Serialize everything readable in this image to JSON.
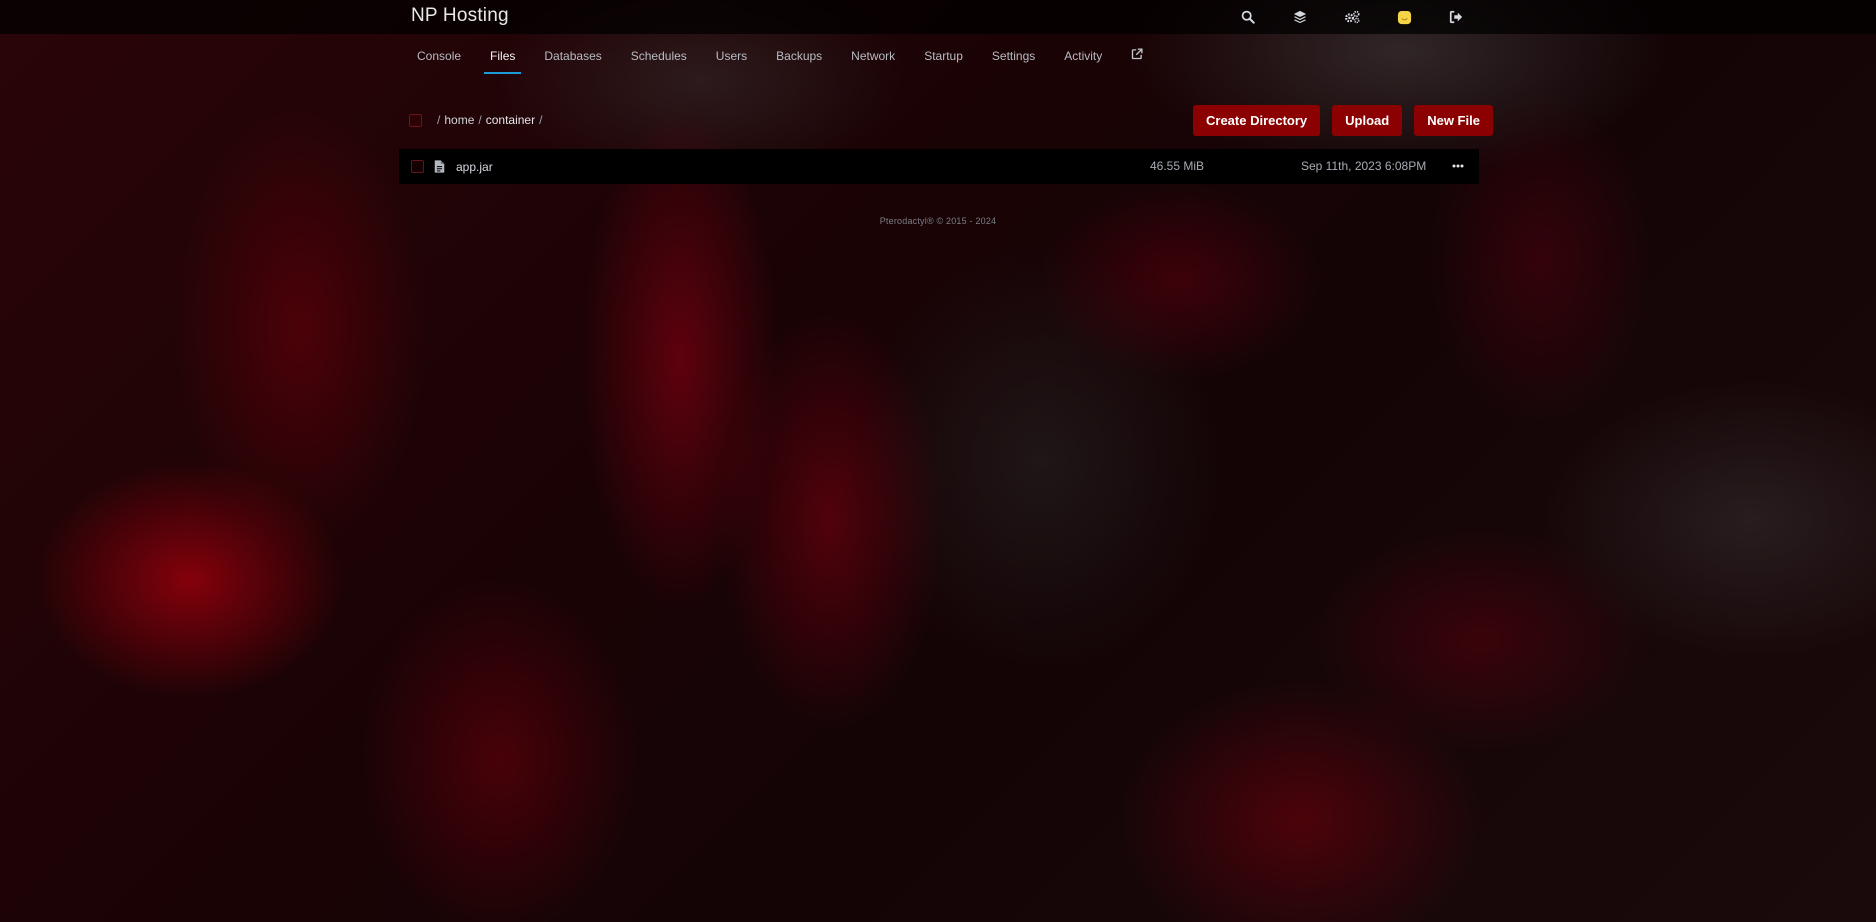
{
  "header": {
    "brand": "NP Hosting",
    "icons": [
      "search-icon",
      "layers-icon",
      "cogs-icon",
      "user-avatar-icon",
      "logout-icon"
    ]
  },
  "tabs": [
    {
      "label": "Console",
      "active": false
    },
    {
      "label": "Files",
      "active": true
    },
    {
      "label": "Databases",
      "active": false
    },
    {
      "label": "Schedules",
      "active": false
    },
    {
      "label": "Users",
      "active": false
    },
    {
      "label": "Backups",
      "active": false
    },
    {
      "label": "Network",
      "active": false
    },
    {
      "label": "Startup",
      "active": false
    },
    {
      "label": "Settings",
      "active": false
    },
    {
      "label": "Activity",
      "active": false
    }
  ],
  "breadcrumb": {
    "home": "home",
    "current": "container"
  },
  "actions": {
    "create_directory": "Create Directory",
    "upload": "Upload",
    "new_file": "New File"
  },
  "files": [
    {
      "name": "app.jar",
      "size": "46.55 MiB",
      "modified": "Sep 11th, 2023 6:08PM"
    }
  ],
  "footer": "Pterodactyl® © 2015 - 2024",
  "colors": {
    "accent_button": "#8b0000",
    "active_tab_underline": "#1d9bd6",
    "avatar": "#f5d547"
  }
}
